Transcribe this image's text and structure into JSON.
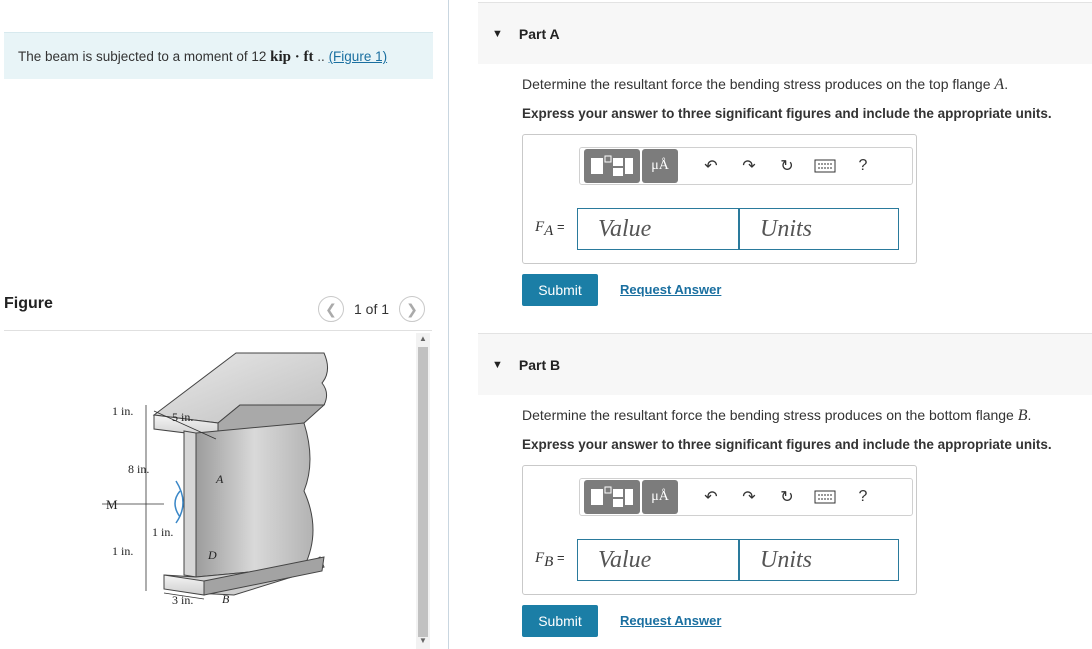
{
  "problem": {
    "text_before": "The beam is subjected to a moment of 12",
    "math": "kip · ft",
    "text_after": "..",
    "figure_link": "(Figure 1)"
  },
  "figure_panel": {
    "title": "Figure",
    "pager_text": "1 of 1",
    "labels": {
      "top_left": "1 in.",
      "top_width": "5 in.",
      "height": "8 in.",
      "moment": "M",
      "web": "1 in.",
      "bottom_left": "1 in.",
      "bottom_width": "3 in.",
      "point_a": "A",
      "point_b": "B",
      "point_d": "D"
    }
  },
  "parts": [
    {
      "title": "Part A",
      "question_before": "Determine the resultant force the bending stress produces on the top flange",
      "question_var": "A",
      "question_after": ".",
      "instructions": "Express your answer to three significant figures and include the appropriate units.",
      "field_label_var": "F",
      "field_label_sub": "A",
      "field_label_eq": " =",
      "value_placeholder": "Value",
      "units_placeholder": "Units",
      "submit": "Submit",
      "request": "Request Answer"
    },
    {
      "title": "Part B",
      "question_before": "Determine the resultant force the bending stress produces on the bottom flange",
      "question_var": "B",
      "question_after": ".",
      "instructions": "Express your answer to three significant figures and include the appropriate units.",
      "field_label_var": "F",
      "field_label_sub": "B",
      "field_label_eq": " =",
      "value_placeholder": "Value",
      "units_placeholder": "Units",
      "submit": "Submit",
      "request": "Request Answer"
    }
  ],
  "toolbar": {
    "units_button": "μÅ",
    "help": "?",
    "icons": [
      "templates-icon",
      "units-icon",
      "undo-icon",
      "redo-icon",
      "reset-icon",
      "keyboard-icon",
      "help-icon"
    ]
  },
  "colors": {
    "accent": "#1b7ea6",
    "link": "#1a6fa0",
    "problem_bg": "#e8f4f7",
    "toolbar_button": "#7c7c7c"
  }
}
